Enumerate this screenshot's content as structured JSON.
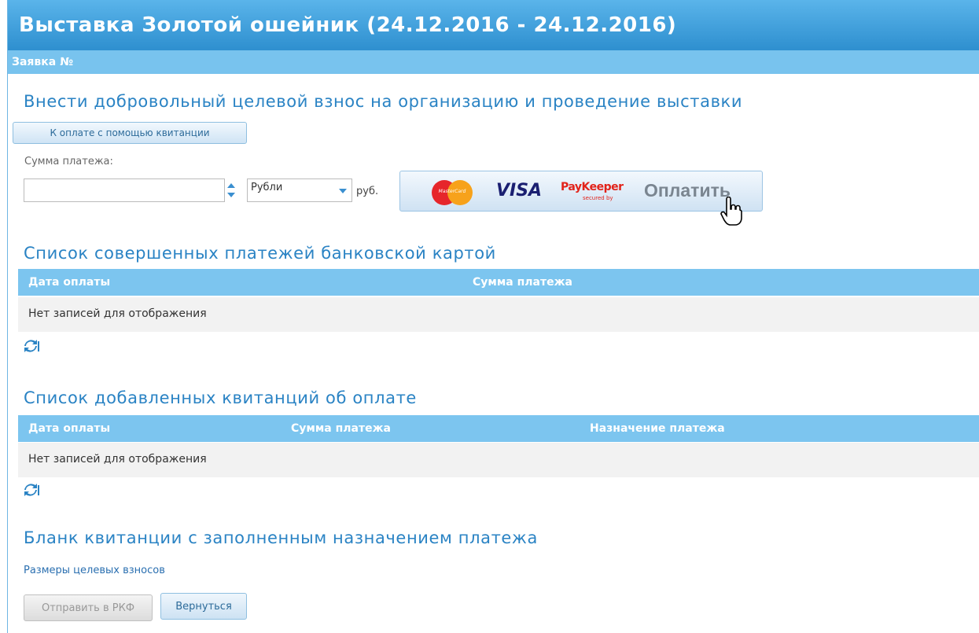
{
  "header": {
    "title": "Выставка Золотой ошейник (24.12.2016 - 24.12.2016)",
    "subtitle": "Заявка №"
  },
  "donation": {
    "title": "Внести добровольный целевой взнос на организацию и проведение выставки",
    "receipt_button": "К оплате с помощью квитанции",
    "amount_label": "Сумма платежа:",
    "amount_value": "",
    "currency": "Рубли",
    "unit": "руб.",
    "pay_button": {
      "mastercard": "MasterCard",
      "visa": "VISA",
      "paykeeper": "PayKeeper",
      "paykeeper_sub": "secured by",
      "label": "Оплатить"
    }
  },
  "card_payments": {
    "title": "Список совершенных платежей банковской картой",
    "columns": [
      "Дата оплаты",
      "Сумма платежа"
    ],
    "empty_text": "Нет записей для отображения"
  },
  "receipts": {
    "title": "Список добавленных квитанций об оплате",
    "columns": [
      "Дата оплаты",
      "Сумма платежа",
      "Назначение платежа"
    ],
    "empty_text": "Нет записей для отображения"
  },
  "blank": {
    "title": "Бланк квитанции с заполненным назначением платежа",
    "link": "Размеры целевых взносов"
  },
  "footer": {
    "send_button": "Отправить в РКФ",
    "back_button": "Вернуться"
  },
  "colors": {
    "accent": "#2a83c4",
    "header_start": "#5ab4ea",
    "header_end": "#2e8fcf",
    "table_head": "#7cc5ef"
  }
}
